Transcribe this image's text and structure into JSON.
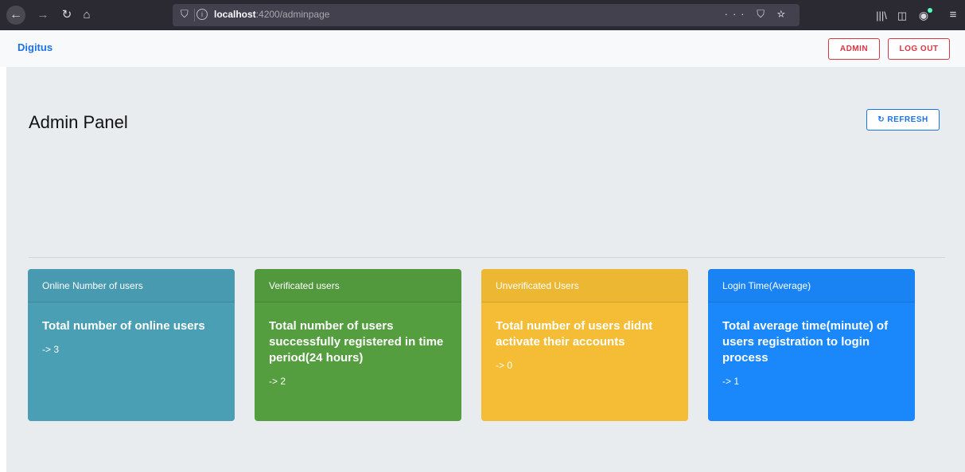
{
  "browser": {
    "url_host": "localhost",
    "url_path": ":4200/adminpage",
    "url_actions": "··· ⛉ ☆"
  },
  "navbar": {
    "brand": "Digitus",
    "admin_label": "ADMIN",
    "logout_label": "LOG OUT"
  },
  "main": {
    "title": "Admin Panel",
    "refresh_label": "↻ REFRESH"
  },
  "cards": [
    {
      "header": "Online Number of users",
      "text": "Total number of online users",
      "value": "-> 3",
      "color": "#4a9fb5"
    },
    {
      "header": "Verificated users",
      "text": "Total number of users successfully registered in time period(24 hours)",
      "value": "-> 2",
      "color": "#559e3f"
    },
    {
      "header": "Unverificated Users",
      "text": "Total number of users didnt activate their accounts",
      "value": "-> 0",
      "color": "#f4bd35"
    },
    {
      "header": "Login Time(Average)",
      "text": "Total average time(minute) of users registration to login process",
      "value": "-> 1",
      "color": "#1a88fb"
    }
  ],
  "colors": {
    "brand": "#1a73e8",
    "danger": "#dc3545",
    "content_bg": "#e9ecef"
  }
}
